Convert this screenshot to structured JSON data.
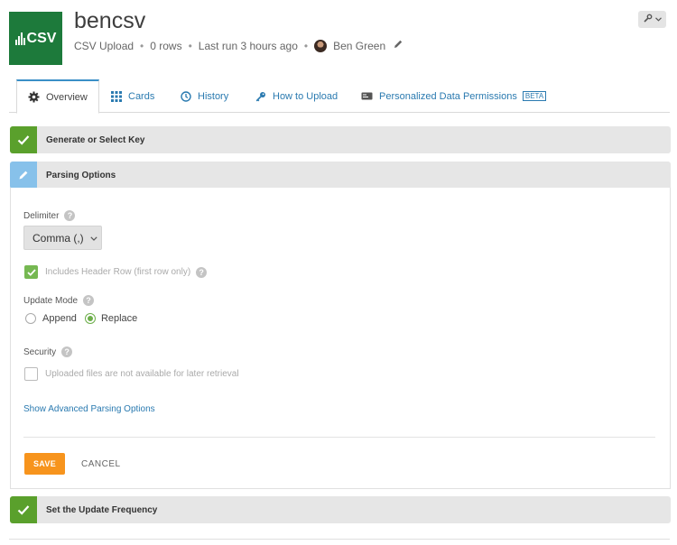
{
  "header": {
    "logo_text": "CSV",
    "title": "bencsv",
    "source": "CSV Upload",
    "rows": "0 rows",
    "last_run": "Last run 3 hours ago",
    "owner": "Ben Green",
    "tools_icon": "wrench-icon"
  },
  "tabs": [
    {
      "label": "Overview",
      "icon": "gear-icon",
      "active": true
    },
    {
      "label": "Cards",
      "icon": "grid-icon",
      "active": false
    },
    {
      "label": "History",
      "icon": "clock-icon",
      "active": false
    },
    {
      "label": "How to Upload",
      "icon": "key-icon",
      "active": false
    },
    {
      "label": "Personalized Data Permissions",
      "icon": "id-card-icon",
      "active": false,
      "badge": "BETA"
    }
  ],
  "steps": {
    "step1": {
      "title": "Generate or Select Key",
      "status": "complete"
    },
    "step2": {
      "title": "Parsing Options",
      "status": "editing"
    },
    "step3": {
      "title": "Set the Update Frequency",
      "status": "complete"
    }
  },
  "parsing": {
    "delimiter_label": "Delimiter",
    "delimiter_value": "Comma (,)",
    "header_row_label": "Includes Header Row (first row only)",
    "header_row_checked": true,
    "update_mode_label": "Update Mode",
    "update_mode_options": [
      "Append",
      "Replace"
    ],
    "update_mode_selected": "Replace",
    "security_label": "Security",
    "security_option": "Uploaded files are not available for later retrieval",
    "security_checked": false,
    "advanced_link": "Show Advanced Parsing Options",
    "save_label": "SAVE",
    "cancel_label": "CANCEL"
  },
  "colors": {
    "success": "#5aa02c",
    "editing": "#87c1ea",
    "primary_action": "#f7941d",
    "link": "#2a7ab0",
    "logo_bg": "#1d7a3b"
  }
}
